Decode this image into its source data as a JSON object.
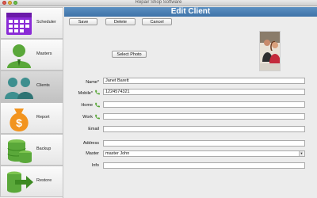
{
  "window": {
    "title": "Repair Shop Software"
  },
  "sidebar": {
    "items": [
      {
        "label": "Scheduler",
        "icon": "calendar-icon"
      },
      {
        "label": "Masters",
        "icon": "person-icon"
      },
      {
        "label": "Clients",
        "icon": "group-icon"
      },
      {
        "label": "Report",
        "icon": "money-bag-icon"
      },
      {
        "label": "Backup",
        "icon": "database-icon"
      },
      {
        "label": "Restore",
        "icon": "restore-arrow-icon"
      }
    ],
    "active": "Clients"
  },
  "header": {
    "title": "Edit Client"
  },
  "toolbar": {
    "save_label": "Save",
    "delete_label": "Delete",
    "cancel_label": "Cancel"
  },
  "photo": {
    "select_label": "Select Photo"
  },
  "form": {
    "name": {
      "label": "Name*",
      "value": "Janet Barett"
    },
    "mobile": {
      "label": "Mobile*",
      "value": "1224574321"
    },
    "home": {
      "label": "Home",
      "value": ""
    },
    "work": {
      "label": "Work",
      "value": ""
    },
    "email": {
      "label": "Email",
      "value": ""
    },
    "address": {
      "label": "Address",
      "value": ""
    },
    "master": {
      "label": "Master",
      "value": "master John"
    },
    "info": {
      "label": "Info",
      "value": ""
    }
  },
  "colors": {
    "header": "#4a7fb5",
    "accent_purple": "#8a2bd6",
    "green": "#5aa83a",
    "orange": "#f2941f",
    "teal": "#3e8f8f"
  }
}
